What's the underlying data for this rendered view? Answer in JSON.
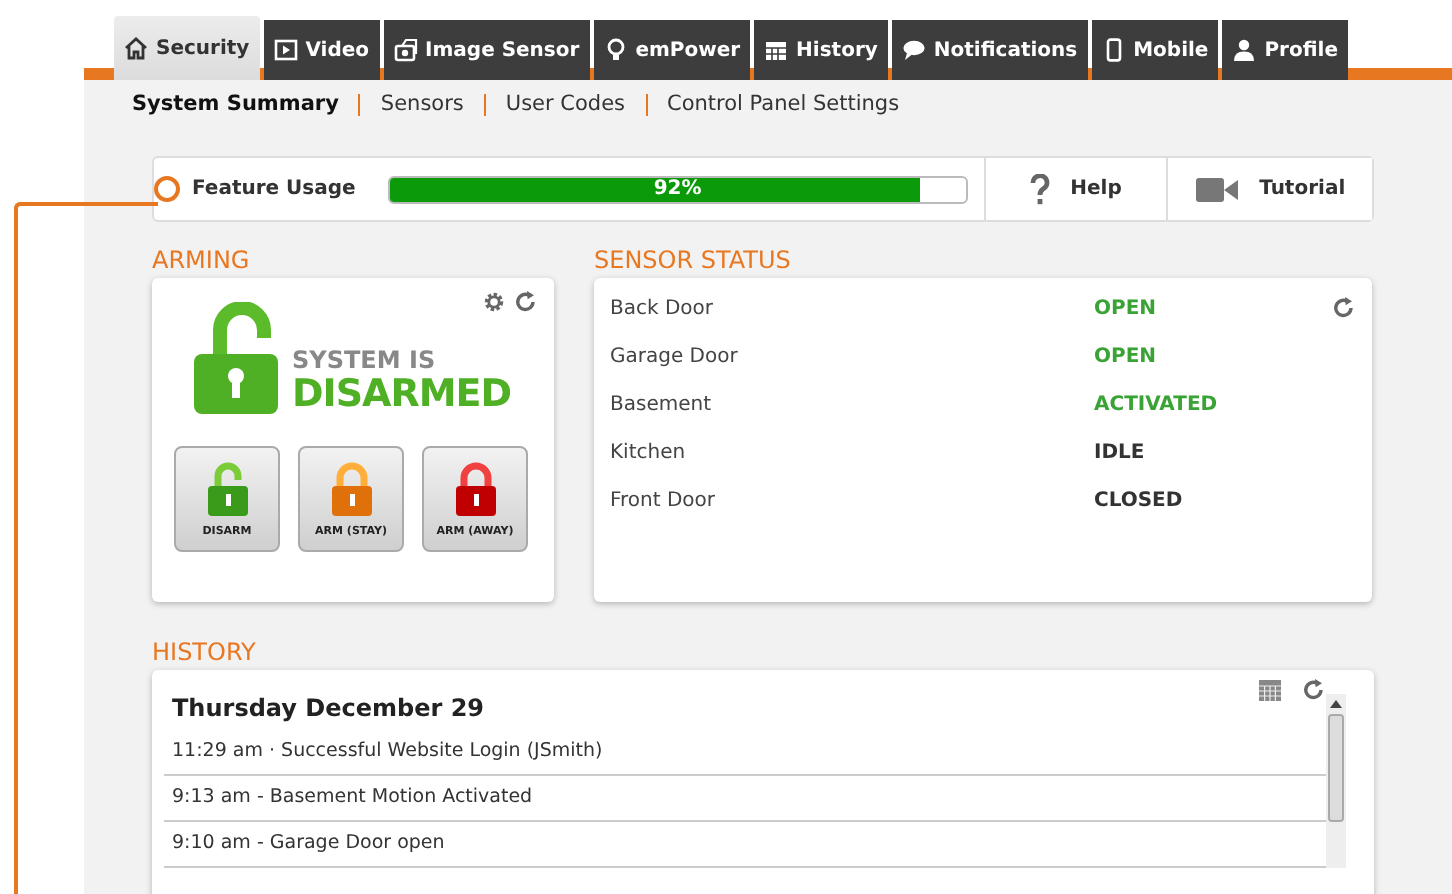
{
  "tabs": [
    {
      "label": "Security",
      "selected": true
    },
    {
      "label": "Video",
      "selected": false
    },
    {
      "label": "Image Sensor",
      "selected": false
    },
    {
      "label": "emPower",
      "selected": false
    },
    {
      "label": "History",
      "selected": false
    },
    {
      "label": "Notifications",
      "selected": false
    },
    {
      "label": "Mobile",
      "selected": false
    },
    {
      "label": "Profile",
      "selected": false
    }
  ],
  "subnav": [
    {
      "label": "System Summary",
      "selected": true
    },
    {
      "label": "Sensors",
      "selected": false
    },
    {
      "label": "User Codes",
      "selected": false
    },
    {
      "label": "Control Panel Settings",
      "selected": false
    }
  ],
  "feature_usage": {
    "label": "Feature Usage",
    "level": 0.92,
    "reading": "92%",
    "help": "Help",
    "tutorial": "Tutorial"
  },
  "arming": {
    "title": "ARMING",
    "status_line1": "SYSTEM IS",
    "status_line2": "DISARMED",
    "buttons": [
      {
        "label": "DISARM",
        "kind": "disarm"
      },
      {
        "label": "ARM (STAY)",
        "kind": "stay"
      },
      {
        "label": "ARM (AWAY)",
        "kind": "away"
      }
    ]
  },
  "sensor_status": {
    "title": "SENSOR STATUS",
    "rows": [
      {
        "name": "Back Door",
        "status": "OPEN",
        "color": "#3aa335"
      },
      {
        "name": "Garage Door",
        "status": "OPEN",
        "color": "#3aa335"
      },
      {
        "name": "Basement",
        "status": "ACTIVATED",
        "color": "#3aa335"
      },
      {
        "name": "Kitchen",
        "status": "IDLE",
        "color": "#333333"
      },
      {
        "name": "Front Door",
        "status": "CLOSED",
        "color": "#333333"
      }
    ]
  },
  "history": {
    "title": "HISTORY",
    "date": "Thursday December 29",
    "entries": [
      "11:29 am · Successful Website Login (JSmith)",
      "9:13 am - Basement Motion Activated",
      "9:10 am - Garage Door open"
    ]
  }
}
